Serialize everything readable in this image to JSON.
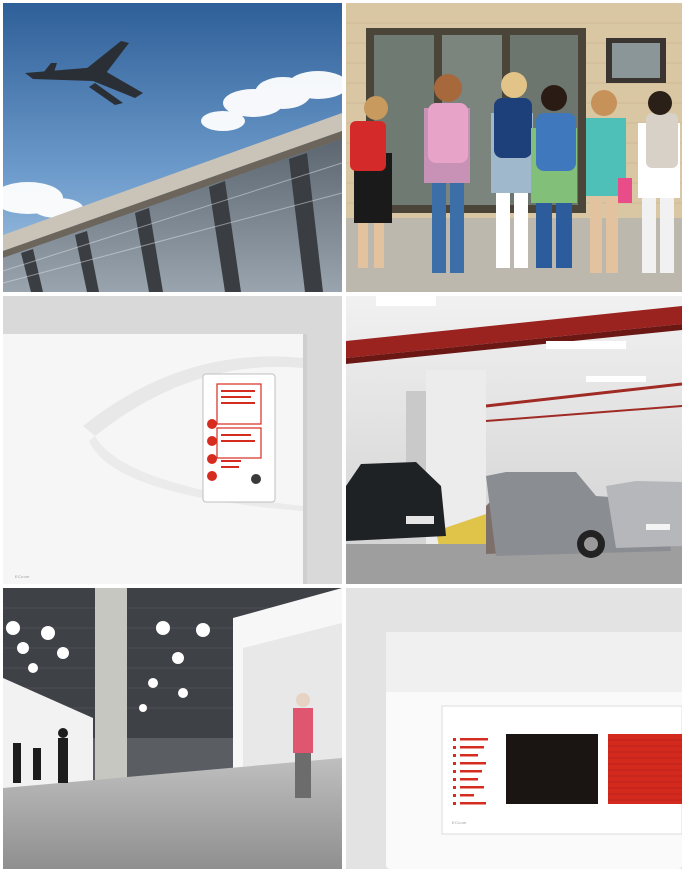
{
  "panel_brand_text": "ECcom",
  "colors": {
    "sky_top": "#3f6fa8",
    "brand_red": "#d62b1f",
    "panel_white": "#f4f4f4",
    "background_gray": "#e3e3e3"
  },
  "photos": [
    {
      "subject": "airport-terminal-with-plane"
    },
    {
      "subject": "schoolchildren-with-backpacks"
    },
    {
      "subject": "fire-alarm-panel-closeup"
    },
    {
      "subject": "underground-parking-garage"
    },
    {
      "subject": "shopping-mall-corridor"
    },
    {
      "subject": "voice-alarm-panel-red-speaker"
    }
  ]
}
